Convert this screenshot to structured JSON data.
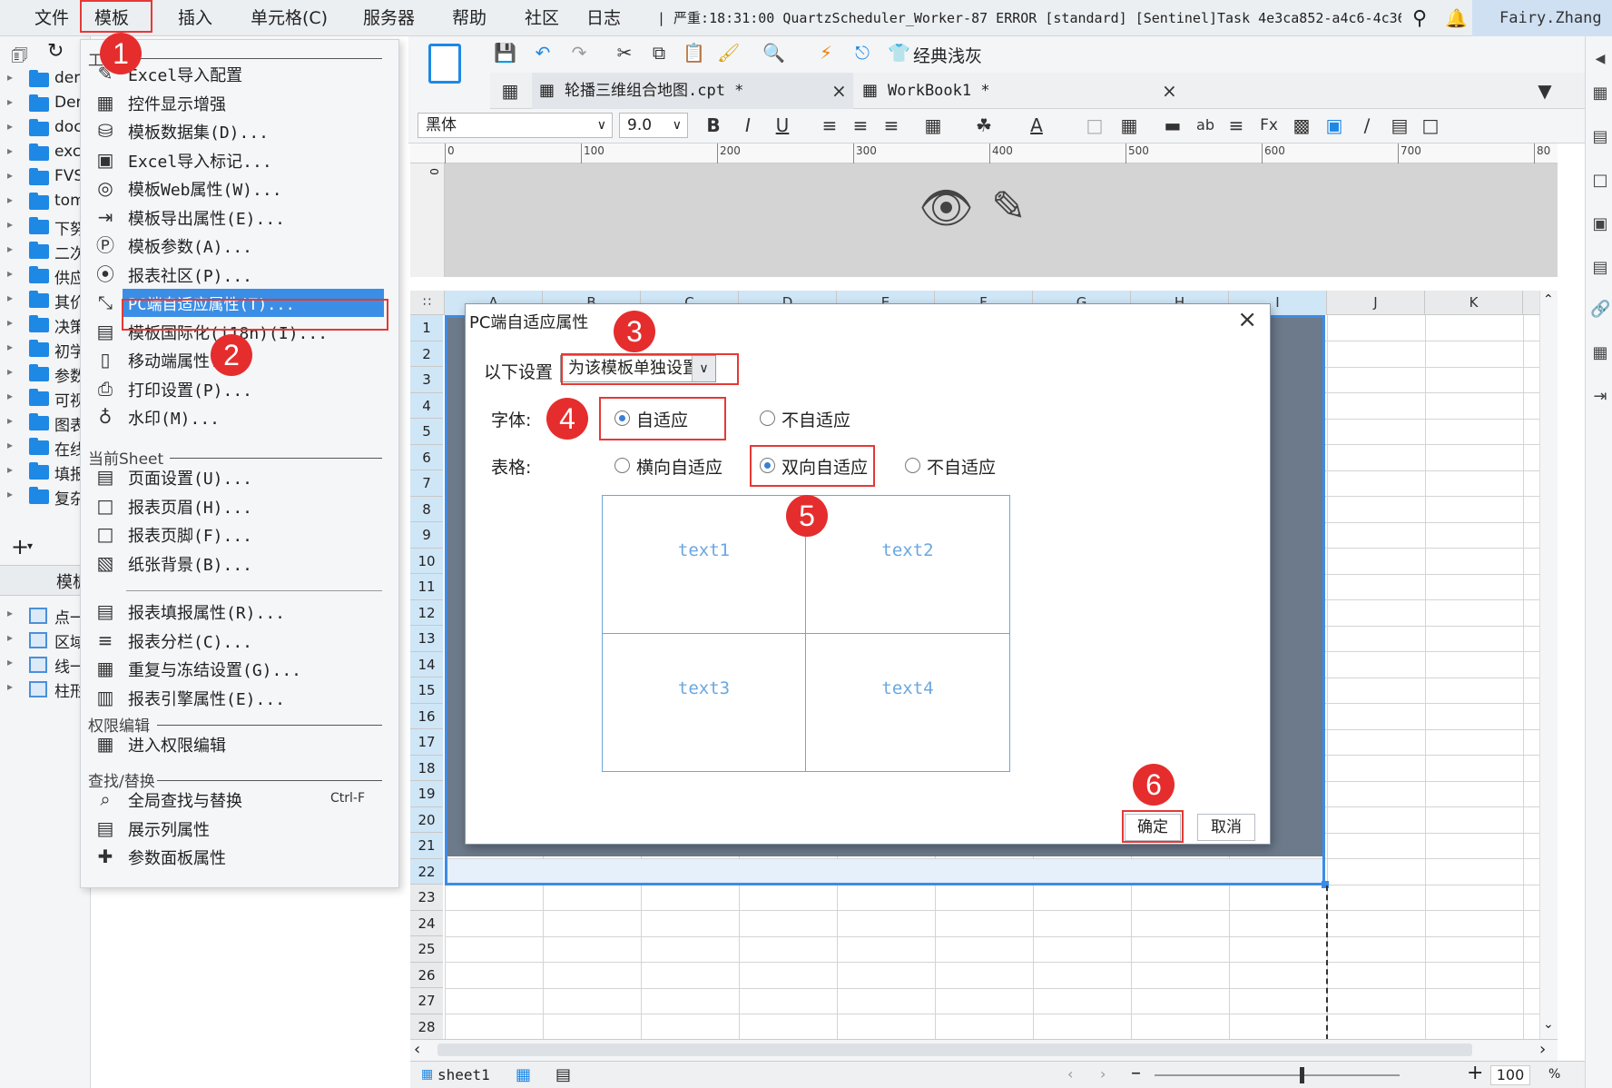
{
  "menubar": {
    "items": [
      "文件",
      "模板",
      "插入",
      "单元格(C)",
      "服务器",
      "帮助",
      "社区",
      "日志"
    ],
    "log_text": "| 严重:18:31:00 QuartzScheduler_Worker-87 ERROR [standard] [Sentinel]Task 4e3ca852-a4c6-4c36...",
    "user": "Fairy.Zhang"
  },
  "left_tree": {
    "folders": [
      "dem",
      "Dem",
      "doc",
      "exc",
      "FVS",
      "tom",
      "下努",
      "二次",
      "供应",
      "其价",
      "决策",
      "初学",
      "参数",
      "可视",
      "图表",
      "在线",
      "填报",
      "复杂"
    ],
    "charts": [
      "点一",
      "区域",
      "线一",
      "柱形"
    ],
    "panel_label": "模板"
  },
  "dropdown": {
    "header": "工",
    "items": [
      {
        "icon": "excel-import-icon",
        "label": "Excel导入配置",
        "short": ""
      },
      {
        "icon": "widget-display-icon",
        "label": "控件显示增强",
        "short": ""
      },
      {
        "icon": "dataset-icon",
        "label": "模板数据集(D)...",
        "short": ""
      },
      {
        "icon": "excel-mark-icon",
        "label": "Excel导入标记...",
        "short": ""
      },
      {
        "icon": "web-icon",
        "label": "模板Web属性(W)...",
        "short": ""
      },
      {
        "icon": "export-icon",
        "label": "模板导出属性(E)...",
        "short": ""
      },
      {
        "icon": "param-icon",
        "label": "模板参数(A)...",
        "short": ""
      },
      {
        "icon": "community-icon",
        "label": "报表社区(P)...",
        "short": ""
      },
      {
        "icon": "pc-adaptive-icon",
        "label": "PC端自适应属性(T)...",
        "short": ""
      },
      {
        "icon": "i18n-icon",
        "label": "模板国际化(i18n)(I)...",
        "short": ""
      },
      {
        "icon": "mobile-icon",
        "label": "移动端属性...",
        "short": ""
      },
      {
        "icon": "print-icon",
        "label": "打印设置(P)...",
        "short": ""
      },
      {
        "icon": "watermark-icon",
        "label": "水印(M)...",
        "short": ""
      }
    ],
    "section_sheet": "当前Sheet",
    "sheet_items": [
      {
        "icon": "page-setup-icon",
        "label": "页面设置(U)..."
      },
      {
        "icon": "header-icon",
        "label": "报表页眉(H)..."
      },
      {
        "icon": "footer-icon",
        "label": "报表页脚(F)..."
      },
      {
        "icon": "background-icon",
        "label": "纸张背景(B)..."
      },
      {
        "icon": "fill-prop-icon",
        "label": "报表填报属性(R)..."
      },
      {
        "icon": "columns-icon",
        "label": "报表分栏(C)..."
      },
      {
        "icon": "freeze-icon",
        "label": "重复与冻结设置(G)..."
      },
      {
        "icon": "engine-icon",
        "label": "报表引擎属性(E)..."
      }
    ],
    "section_perm": "权限编辑",
    "perm_items": [
      {
        "icon": "permission-icon",
        "label": "进入权限编辑"
      }
    ],
    "section_find": "查找/替换",
    "find_items": [
      {
        "icon": "search-icon",
        "label": "全局查找与替换",
        "short": "Ctrl-F"
      },
      {
        "icon": "column-prop-icon",
        "label": "展示列属性",
        "short": ""
      },
      {
        "icon": "param-panel-icon",
        "label": "参数面板属性",
        "short": ""
      }
    ]
  },
  "toolbar": {
    "style_label": "经典浅灰",
    "font_name": "黑体",
    "font_size": "9.0"
  },
  "tabs": [
    {
      "label": "轮播三维组合地图.cpt *"
    },
    {
      "label": "WorkBook1 *"
    }
  ],
  "ruler": [
    "0",
    "100",
    "200",
    "300",
    "400",
    "500",
    "600",
    "700",
    "80"
  ],
  "grid": {
    "columns": [
      "A",
      "B",
      "C",
      "D",
      "E",
      "F",
      "G",
      "H",
      "I",
      "J",
      "K"
    ],
    "rows": [
      "1",
      "2",
      "3",
      "4",
      "5",
      "6",
      "7",
      "8",
      "9",
      "10",
      "11",
      "12",
      "13",
      "14",
      "15",
      "16",
      "17",
      "18",
      "19",
      "20",
      "21",
      "22",
      "23",
      "24",
      "25",
      "26",
      "27",
      "28"
    ]
  },
  "statusbar": {
    "sheet": "sheet1",
    "zoom": "100",
    "zoom_unit": "%"
  },
  "dialog": {
    "title": "PC端自适应属性",
    "setting_label": "以下设置",
    "setting_value": "为该模板单独设置",
    "font_label": "字体:",
    "font_options": [
      "自适应",
      "不自适应"
    ],
    "font_selected": "自适应",
    "table_label": "表格:",
    "table_options": [
      "横向自适应",
      "双向自适应",
      "不自适应"
    ],
    "table_selected": "双向自适应",
    "preview": [
      "text1",
      "text2",
      "text3",
      "text4"
    ],
    "ok": "确定",
    "cancel": "取消"
  },
  "badges": [
    "1",
    "2",
    "3",
    "4",
    "5",
    "6"
  ],
  "colors": {
    "accent": "#3a8ee6",
    "highlight": "#e53935",
    "badge": "#e52d2d",
    "sheet_dark": "#6c7a8b"
  }
}
